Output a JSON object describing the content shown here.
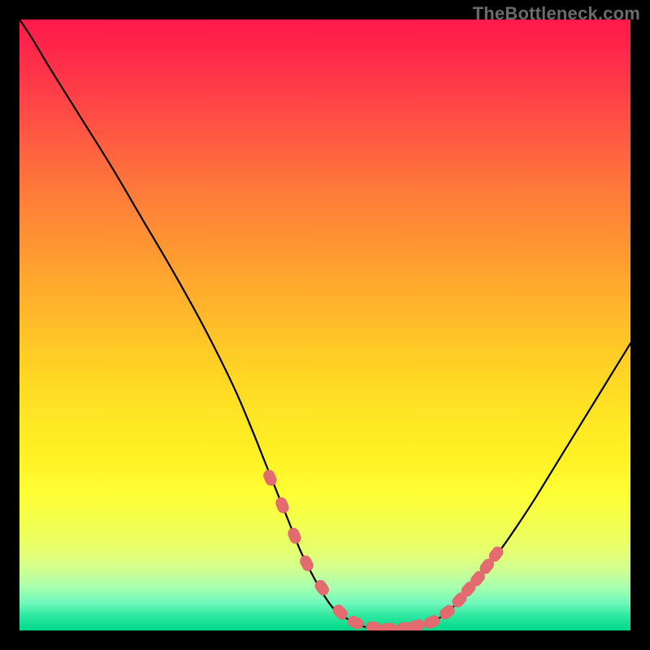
{
  "watermark": "TheBottleneck.com",
  "chart_data": {
    "type": "line",
    "title": "",
    "xlabel": "",
    "ylabel": "",
    "xlim": [
      0,
      100
    ],
    "ylim": [
      0,
      100
    ],
    "x": [
      0,
      2,
      5,
      10,
      15,
      20,
      25,
      30,
      35,
      38,
      40,
      42,
      44,
      46,
      48,
      50,
      52,
      55,
      57,
      60,
      62,
      64,
      66,
      68,
      70,
      73,
      76,
      80,
      84,
      88,
      92,
      96,
      100
    ],
    "values": [
      100,
      97,
      92,
      84,
      76,
      67.5,
      59,
      50,
      40,
      33,
      28,
      23,
      18,
      13,
      9,
      5.5,
      3,
      1.2,
      0.5,
      0.3,
      0.3,
      0.4,
      0.8,
      1.6,
      3,
      5.8,
      9.5,
      15,
      21,
      27.5,
      34,
      40.5,
      47
    ],
    "highlight_points_x": [
      41,
      43,
      45,
      47,
      49.5,
      52.5,
      55,
      58,
      60.5,
      63,
      65,
      67.5,
      70,
      72,
      73.5,
      75,
      76.5,
      78
    ],
    "highlight_points_y": [
      25,
      20.5,
      15.5,
      11,
      7,
      3,
      1.3,
      0.5,
      0.3,
      0.4,
      0.8,
      1.4,
      3,
      5,
      6.8,
      8.5,
      10.5,
      12.5
    ],
    "highlight_color": "#e36a6e",
    "curve_color": "#000000"
  }
}
